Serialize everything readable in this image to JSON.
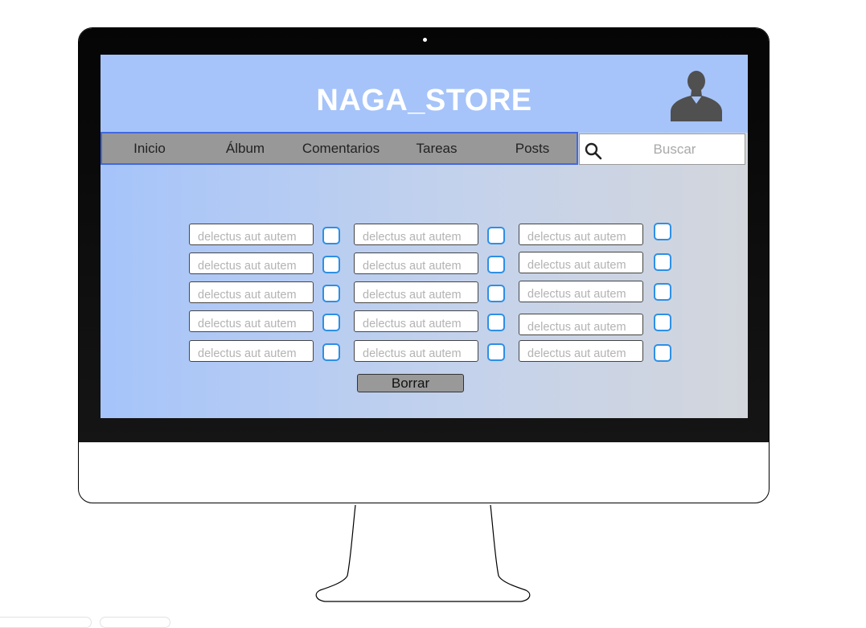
{
  "header": {
    "title": "NAGA_STORE"
  },
  "nav": {
    "items": [
      {
        "label": "Inicio"
      },
      {
        "label": "Álbum"
      },
      {
        "label": "Comentarios"
      },
      {
        "label": "Tareas"
      },
      {
        "label": "Posts"
      }
    ]
  },
  "search": {
    "placeholder": "Buscar"
  },
  "tasks": {
    "placeholder": "delectus aut autem",
    "rows": 5,
    "columns": 3
  },
  "actions": {
    "delete_label": "Borrar"
  },
  "colors": {
    "header_bg": "#a6c4fa",
    "nav_bg": "#989898",
    "nav_border": "#4169e1",
    "checkbox_border": "#2d8fe6",
    "title_text": "#ffffff"
  },
  "icons": [
    "user-avatar-icon",
    "search-icon",
    "checkbox-icon"
  ]
}
